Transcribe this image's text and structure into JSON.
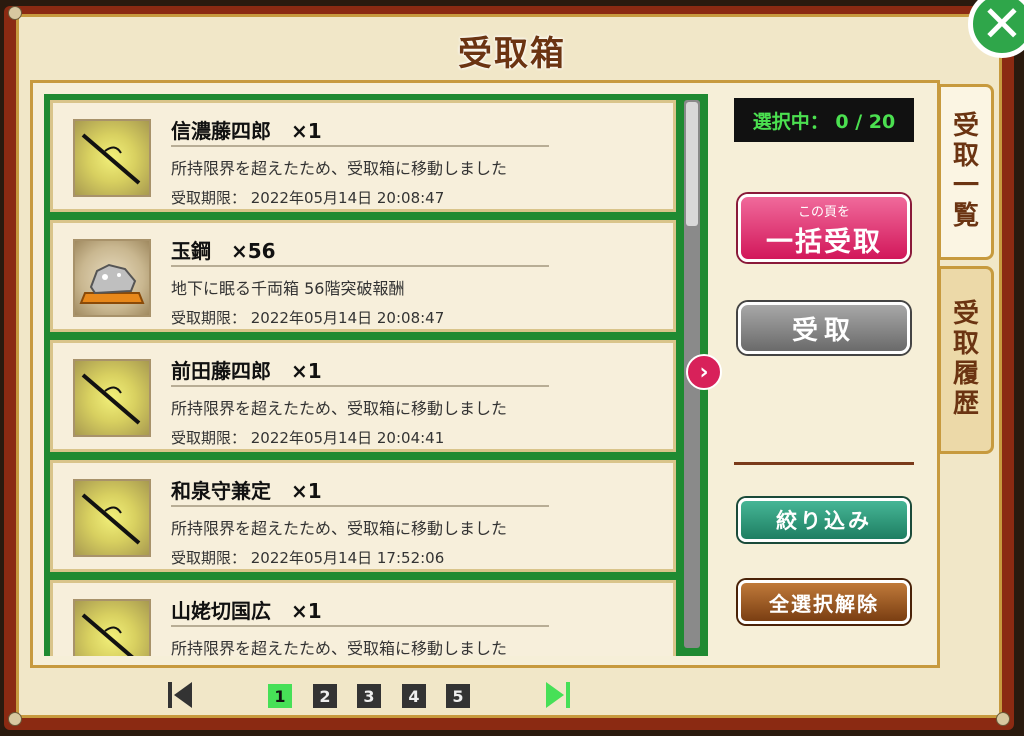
{
  "title": "受取箱",
  "selection_counter": "選択中： 0 / 20",
  "items": [
    {
      "name": "信濃藤四郎　×1",
      "description": "所持限界を超えたため、受取箱に移動しました",
      "expiry": "受取期限： 2022年05月14日 20:08:47",
      "icon": "sword-icon"
    },
    {
      "name": "玉鋼　×56",
      "description": "地下に眠る千両箱 56階突破報酬",
      "expiry": "受取期限： 2022年05月14日 20:08:47",
      "icon": "steel-ore-icon"
    },
    {
      "name": "前田藤四郎　×1",
      "description": "所持限界を超えたため、受取箱に移動しました",
      "expiry": "受取期限： 2022年05月14日 20:04:41",
      "icon": "sword-icon"
    },
    {
      "name": "和泉守兼定　×1",
      "description": "所持限界を超えたため、受取箱に移動しました",
      "expiry": "受取期限： 2022年05月14日 17:52:06",
      "icon": "sword-icon"
    },
    {
      "name": "山姥切国広　×1",
      "description": "所持限界を超えたため、受取箱に移動しました",
      "expiry": "",
      "icon": "sword-icon"
    }
  ],
  "buttons": {
    "bulk_small": "この頁を",
    "bulk_main": "一括受取",
    "receive": "受取",
    "filter": "絞り込み",
    "deselect_all": "全選択解除"
  },
  "tabs": {
    "list": [
      "受",
      "取",
      "一",
      "覧"
    ],
    "history": [
      "受",
      "取",
      "履",
      "歴"
    ]
  },
  "pagination": {
    "pages": [
      "1",
      "2",
      "3",
      "4",
      "5"
    ],
    "current": "1"
  },
  "colors": {
    "list_border": "#1f8a31",
    "bulk_button": "#d2175a",
    "filter_button": "#1e7e62",
    "deselect_button": "#7a3e12",
    "active_page": "#47e057"
  }
}
